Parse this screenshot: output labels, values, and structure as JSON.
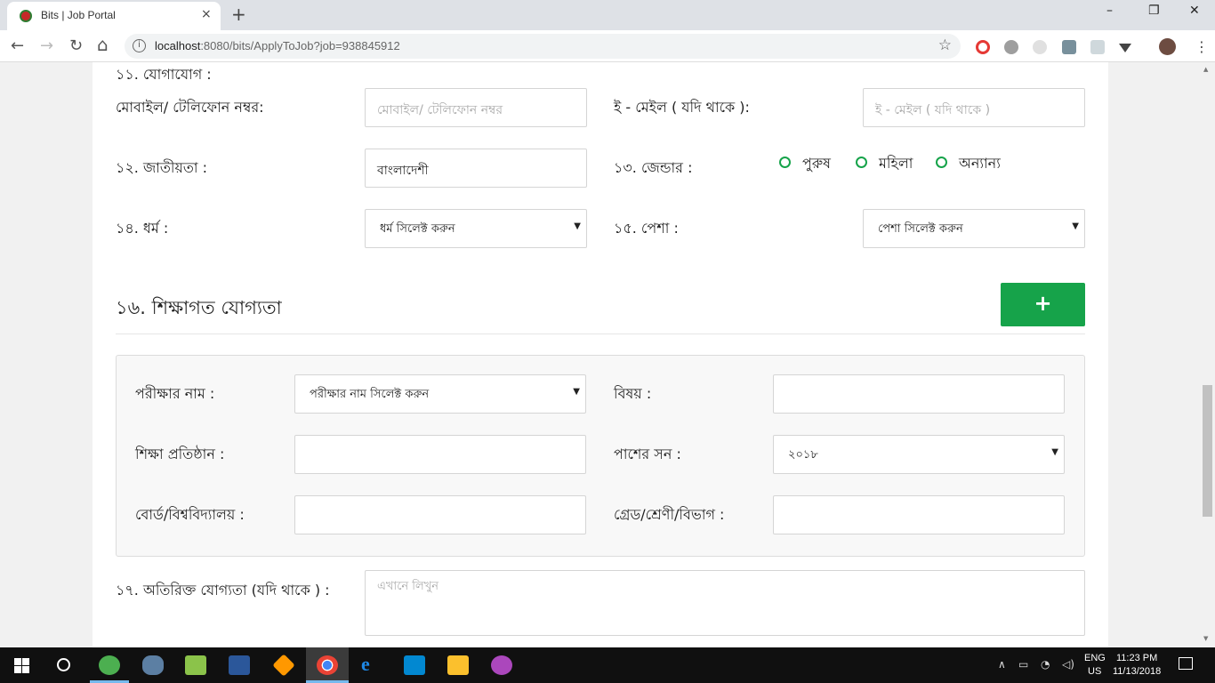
{
  "browser": {
    "tab_title": "Bits | Job Portal",
    "tab_close": "×",
    "new_tab": "+",
    "url_host": "localhost",
    "url_rest": ":8080/bits/ApplyToJob?job=938845912",
    "win_min": "–",
    "win_max": "❐",
    "win_close": "✕",
    "back": "←",
    "forward": "→",
    "reload": "↻",
    "home": "⌂",
    "info": "i",
    "star": "☆"
  },
  "form": {
    "contact_heading": "১১. যোগাযোগ :",
    "mobile_label": "মোবাইল/ টেলিফোন নম্বর:",
    "mobile_placeholder": "মোবাইল/ টেলিফোন নম্বর",
    "email_label": "ই - মেইল ( যদি থাকে ):",
    "email_placeholder": "ই - মেইল ( যদি থাকে )",
    "nationality_label": "১২. জাতীয়তা :",
    "nationality_value": "বাংলাদেশী",
    "gender_label": "১৩. জেন্ডার :",
    "gender_options": [
      "পুরুষ",
      "মহিলা",
      "অন্যান্য"
    ],
    "religion_label": "১৪. ধর্ম :",
    "religion_select": "ধর্ম সিলেক্ট করুন",
    "occupation_label": "১৫. পেশা :",
    "occupation_select": "পেশা সিলেক্ট করুন",
    "education_title": "১৬. শিক্ষাগত যোগ্যতা",
    "add_button": "+",
    "exam_label": "পরীক্ষার নাম :",
    "exam_select": "পরীক্ষার নাম সিলেক্ট করুন",
    "subject_label": "বিষয় :",
    "institution_label": "শিক্ষা প্রতিষ্ঠান :",
    "passing_year_label": "পাশের সন :",
    "passing_year_value": "২০১৮",
    "board_label": "বোর্ড/বিশ্ববিদ্যালয় :",
    "grade_label": "গ্রেড/শ্রেণী/বিভাগ :",
    "extra_label": "১৭. অতিরিক্ত যোগ্যতা (যদি থাকে ) :",
    "extra_placeholder": "এখানে লিখুন",
    "dropdown_arrow": "▼"
  },
  "taskbar": {
    "lang_line1": "ENG",
    "lang_line2": "US",
    "time": "11:23 PM",
    "date": "11/13/2018"
  },
  "colors": {
    "accent_green": "#16a34a",
    "favicon_red": "#c62828"
  }
}
